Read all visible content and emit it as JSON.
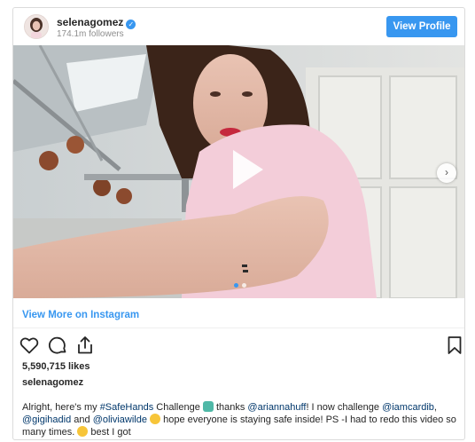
{
  "header": {
    "username": "selenagomez",
    "verified_icon": "verified-badge-icon",
    "followers": "174.1m followers",
    "view_profile_label": "View Profile"
  },
  "media": {
    "play_icon": "play-icon",
    "next_icon": "chevron-right-icon",
    "carousel_dots": 2,
    "active_dot": 1
  },
  "view_more_label": "View More on Instagram",
  "actions": [
    "heart-icon",
    "comment-icon",
    "share-icon",
    "bookmark-icon"
  ],
  "likes": "5,590,715 likes",
  "caption_user": "selenagomez",
  "caption": {
    "part1": "Alright, here's my ",
    "tag": "#SafeHands",
    "part2": " Challenge ",
    "part3": " thanks ",
    "mention1": "@ariannahuff",
    "part4": "! I now challenge ",
    "mention2": "@iamcardib",
    "part5": ", ",
    "mention3": "@gigihadid",
    "part6": " and ",
    "mention4": "@oliviawilde",
    "part7": " hope everyone is staying safe inside! PS -I had to redo this video so many times. ",
    "part8": " best I got"
  },
  "colors": {
    "accent": "#3897f0",
    "link": "#00376b",
    "text": "#262626",
    "muted": "#8e8e8e"
  }
}
